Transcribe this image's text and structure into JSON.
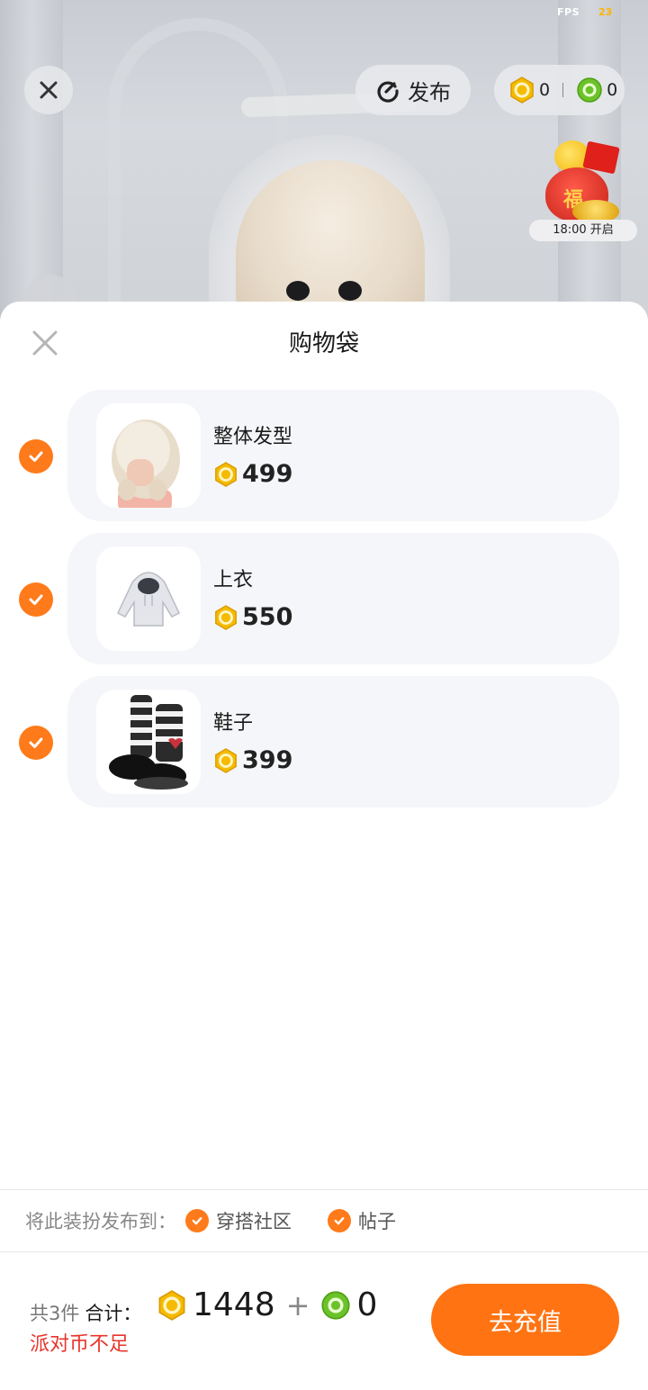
{
  "status": {
    "fps_label": "FPS",
    "fps_value": "23"
  },
  "toolbar": {
    "publish_label": "发布",
    "gold_balance": "0",
    "green_balance": "0"
  },
  "event": {
    "timer_label": "18:00 开启",
    "badge_char": "福"
  },
  "sheet": {
    "title": "购物袋",
    "items": [
      {
        "name": "整体发型",
        "price": "499",
        "checked": true
      },
      {
        "name": "上衣",
        "price": "550",
        "checked": true
      },
      {
        "name": "鞋子",
        "price": "399",
        "checked": true
      }
    ],
    "publish_to": {
      "label": "将此装扮发布到：",
      "options": [
        {
          "label": "穿搭社区",
          "checked": true
        },
        {
          "label": "帖子",
          "checked": true
        }
      ]
    },
    "footer": {
      "count_label": "共3件",
      "total_label": "合计：",
      "gold_total": "1448",
      "plus": "+",
      "green_total": "0",
      "warning": "派对币不足",
      "recharge_label": "去充值"
    }
  },
  "colors": {
    "accent": "#ff7312",
    "gold": "#f2b400",
    "green": "#6cc22a",
    "warning": "#e8362c"
  },
  "icons": [
    "close-icon",
    "publish-icon",
    "gold-coin-icon",
    "green-coin-icon",
    "camera-icon",
    "check-icon"
  ]
}
